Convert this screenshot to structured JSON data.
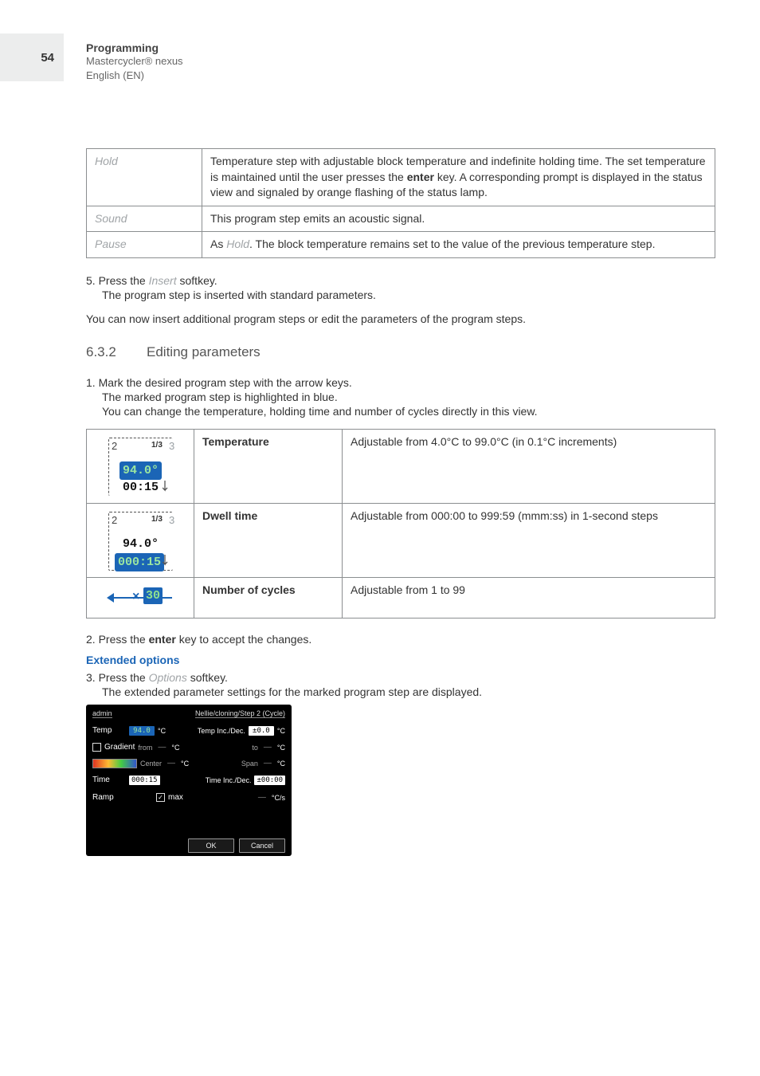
{
  "page": {
    "number": "54"
  },
  "header": {
    "title": "Programming",
    "product": "Mastercycler® nexus",
    "lang": "English (EN)"
  },
  "defs": {
    "hold": {
      "label": "Hold",
      "desc_a": "Temperature step with adjustable block temperature and indefinite holding time. The set temperature is maintained until the user presses the ",
      "desc_key": "enter",
      "desc_b": " key. A corresponding prompt is displayed in the status view and signaled by orange flashing of the status lamp."
    },
    "sound": {
      "label": "Sound",
      "desc": "This program step emits an acoustic signal."
    },
    "pause": {
      "label": "Pause",
      "desc_a": "As ",
      "desc_hold": "Hold",
      "desc_b": ". The block temperature remains set to the value of the previous temperature step."
    }
  },
  "step5": {
    "line_a": "5.  Press the ",
    "softkey": "Insert",
    "line_b": " softkey.",
    "result": "The program step is inserted with standard parameters."
  },
  "after_insert": "You can now insert additional program steps or edit the parameters of the program steps.",
  "section": {
    "num": "6.3.2",
    "title": "Editing parameters"
  },
  "edit_step1": {
    "line": "1.  Mark the desired program step with the arrow keys.",
    "sub1": "The marked program step is highlighted in blue.",
    "sub2": "You can change the temperature, holding time and number of cycles directly in this view."
  },
  "params": {
    "temp": {
      "name": "Temperature",
      "desc": "Adjustable from 4.0°C to 99.0°C (in 0.1°C increments)",
      "icon": {
        "left": "2",
        "frac": "1/3",
        "right": "3",
        "val": "94.0°",
        "time": "00:15"
      }
    },
    "dwell": {
      "name": "Dwell time",
      "desc": "Adjustable from 000:00 to 999:59 (mmm:ss) in 1-second steps",
      "icon": {
        "left": "2",
        "frac": "1/3",
        "right": "3",
        "val": "94.0°",
        "time": "000:15"
      }
    },
    "cycles": {
      "name": "Number of cycles",
      "desc": "Adjustable from 1 to 99",
      "icon": {
        "x": "×",
        "val": "30"
      }
    }
  },
  "edit_step2": {
    "a": "2.  Press the ",
    "key": "enter",
    "b": " key to accept the changes."
  },
  "extended": {
    "header": "Extended options"
  },
  "edit_step3": {
    "a": "3.  Press the ",
    "softkey": "Options",
    "b": " softkey.",
    "result": "The extended parameter settings for the marked program step are displayed."
  },
  "device": {
    "top_left": "admin",
    "top_right": "Nellie/cloning/Step 2 (Cycle)",
    "row_temp": {
      "lbl": "Temp",
      "val": "94.0",
      "unit": "°C",
      "lbl2": "Temp Inc./Dec.",
      "val2": "±0.0",
      "unit2": "°C"
    },
    "row_grad1": {
      "chk": "",
      "lbl": "Gradient",
      "from_lbl": "from",
      "from_val": "—",
      "unit": "°C",
      "to_lbl": "to",
      "to_val": "—",
      "unit2": "°C"
    },
    "row_grad2": {
      "center_lbl": "Center",
      "center_val": "—",
      "unit": "°C",
      "span_lbl": "Span",
      "span_val": "—",
      "unit2": "°C"
    },
    "row_time": {
      "lbl": "Time",
      "val": "000:15",
      "lbl2": "Time Inc./Dec.",
      "val2": "±00:00"
    },
    "row_ramp": {
      "lbl": "Ramp",
      "chk": "✓",
      "max": "max",
      "val": "—",
      "unit": "°C/s"
    },
    "buttons": {
      "ok": "OK",
      "cancel": "Cancel"
    }
  }
}
